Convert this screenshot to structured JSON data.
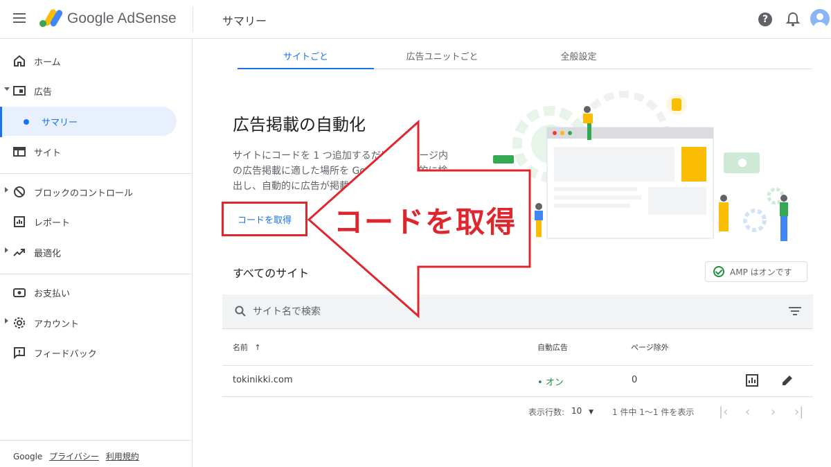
{
  "topbar": {
    "brand": "Google AdSense",
    "page_title": "サマリー",
    "help_glyph": "?"
  },
  "sidebar": {
    "items": [
      {
        "label": "ホーム",
        "icon": "home-icon"
      },
      {
        "label": "広告",
        "icon": "ads-icon"
      },
      {
        "label": "サマリー",
        "icon": "dot"
      },
      {
        "label": "サイト",
        "icon": "site-icon"
      },
      {
        "label": "ブロックのコントロール",
        "icon": "block-icon"
      },
      {
        "label": "レポート",
        "icon": "report-icon"
      },
      {
        "label": "最適化",
        "icon": "trending-icon"
      },
      {
        "label": "お支払い",
        "icon": "payment-icon"
      },
      {
        "label": "アカウント",
        "icon": "gear-icon"
      },
      {
        "label": "フィードバック",
        "icon": "feedback-icon"
      }
    ],
    "footer": {
      "brand": "Google",
      "privacy": "プライバシー",
      "terms": "利用規約"
    }
  },
  "tabs": [
    {
      "label": "サイトごと",
      "active": true
    },
    {
      "label": "広告ユニットごと",
      "active": false
    },
    {
      "label": "全般設定",
      "active": false
    }
  ],
  "hero": {
    "title": "広告掲載の自動化",
    "description": "サイトにコードを 1 つ追加するだけで、ページ内の広告掲載に適した場所を Google が自動的に検出し、自動的に広告が掲載されます。",
    "cta": "コードを取得"
  },
  "sites": {
    "title": "すべてのサイト",
    "amp_label": "AMP はオンです",
    "search_placeholder": "サイト名で検索",
    "columns": [
      "名前",
      "自動広告",
      "ページ除外"
    ],
    "sort_arrow": "↑",
    "rows": [
      {
        "name": "tokinikki.com",
        "auto_ads": "オン",
        "page_exclusions": "0"
      }
    ],
    "pager": {
      "rows_label": "表示行数:",
      "rows_value": "10",
      "range": "1 件中 1〜1 件を表示"
    }
  },
  "annotation": {
    "text": "コードを取得",
    "color": "#e0262d"
  },
  "colors": {
    "accent": "#1a73e8",
    "status_on": "#1e8e3e"
  }
}
